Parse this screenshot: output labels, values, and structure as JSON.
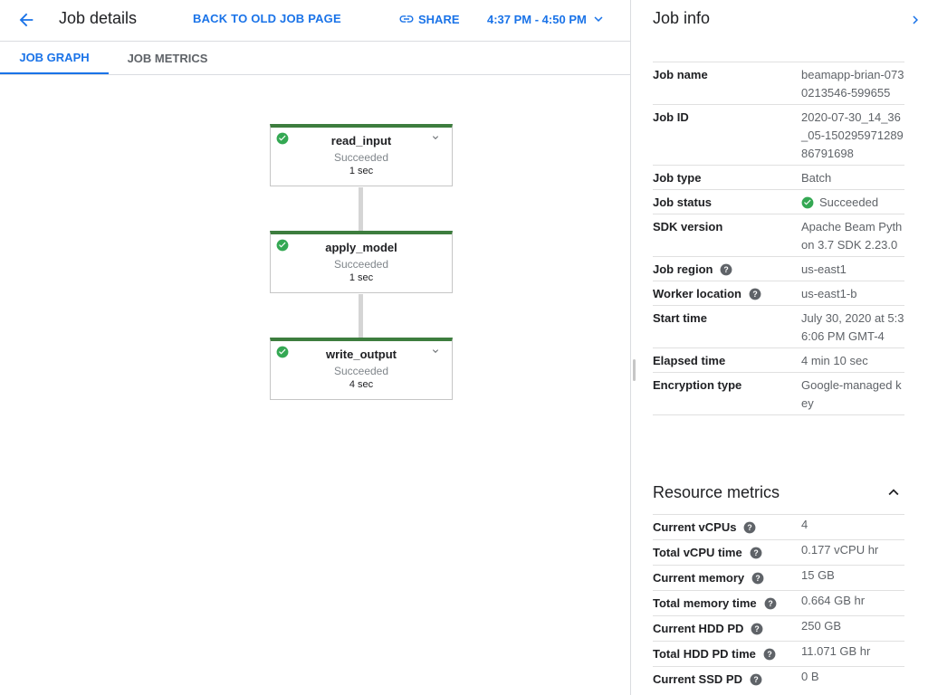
{
  "header": {
    "title": "Job details",
    "back_to_old": "BACK TO OLD JOB PAGE",
    "share": "SHARE",
    "time_range": "4:37 PM - 4:50 PM"
  },
  "tabs": [
    {
      "label": "JOB GRAPH",
      "active": true
    },
    {
      "label": "JOB METRICS",
      "active": false
    }
  ],
  "graph": {
    "nodes": [
      {
        "name": "read_input",
        "status": "Succeeded",
        "duration": "1 sec"
      },
      {
        "name": "apply_model",
        "status": "Succeeded",
        "duration": "1 sec"
      },
      {
        "name": "write_output",
        "status": "Succeeded",
        "duration": "4 sec"
      }
    ]
  },
  "job_info": {
    "title": "Job info",
    "rows": [
      {
        "key": "Job name",
        "value": "beamapp-brian-0730213546-599655"
      },
      {
        "key": "Job ID",
        "value": "2020-07-30_14_36_05-15029597128986791698"
      },
      {
        "key": "Job type",
        "value": "Batch"
      },
      {
        "key": "Job status",
        "value": "Succeeded"
      },
      {
        "key": "SDK version",
        "value": "Apache Beam Python 3.7 SDK 2.23.0"
      },
      {
        "key": "Job region",
        "value": "us-east1"
      },
      {
        "key": "Worker location",
        "value": "us-east1-b"
      },
      {
        "key": "Start time",
        "value": "July 30, 2020 at 5:36:06 PM GMT-4"
      },
      {
        "key": "Elapsed time",
        "value": "4 min 10 sec"
      },
      {
        "key": "Encryption type",
        "value": "Google-managed key"
      }
    ]
  },
  "resource_metrics": {
    "title": "Resource metrics",
    "rows": [
      {
        "key": "Current vCPUs",
        "value": "4"
      },
      {
        "key": "Total vCPU time",
        "value": "0.177 vCPU hr"
      },
      {
        "key": "Current memory",
        "value": "15 GB"
      },
      {
        "key": "Total memory time",
        "value": "0.664 GB hr"
      },
      {
        "key": "Current HDD PD",
        "value": "250 GB"
      },
      {
        "key": "Total HDD PD time",
        "value": "11.071 GB hr"
      },
      {
        "key": "Current SSD PD",
        "value": "0 B"
      }
    ]
  },
  "colors": {
    "accent": "#1a73e8",
    "success": "#3d7d3e",
    "success_icon": "#34a853"
  },
  "icons": {
    "back": "arrow-back-icon",
    "share": "link-icon",
    "dropdown": "chevron-down-icon",
    "collapse": "chevron-right-icon",
    "success": "check-circle-icon",
    "help": "help-circle-icon",
    "expand_less": "chevron-up-icon"
  }
}
